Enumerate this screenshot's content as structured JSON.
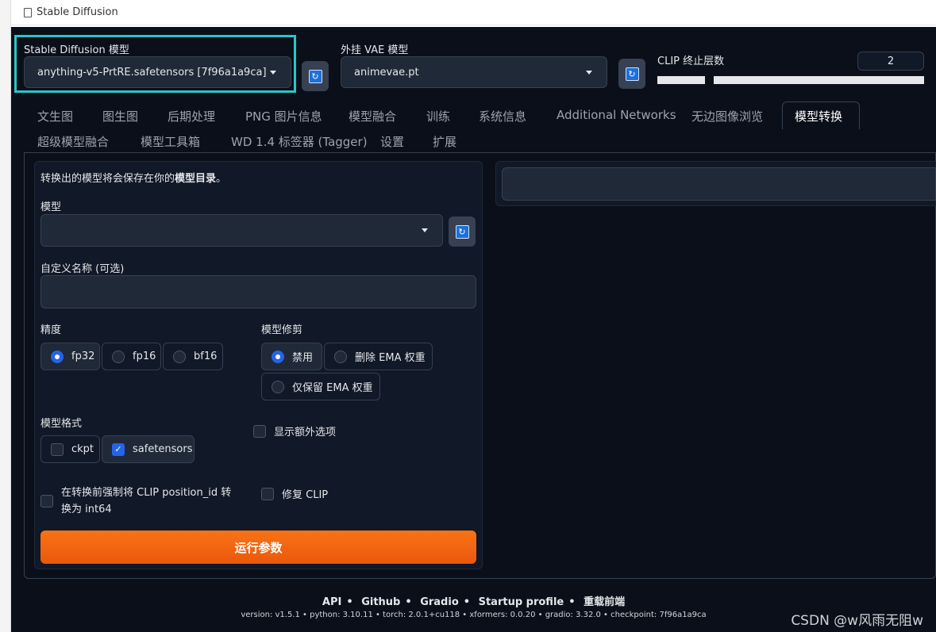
{
  "window": {
    "title": "Stable Diffusion"
  },
  "header": {
    "model_label": "Stable Diffusion 模型",
    "model_value": "anything-v5-PrtRE.safetensors [7f96a1a9ca]",
    "vae_label": "外挂 VAE 模型",
    "vae_value": "animevae.pt",
    "clip_label": "CLIP 终止层数",
    "clip_value": "2",
    "clip_slider": {
      "min": 1,
      "max": 12,
      "value": 2
    }
  },
  "tabs": {
    "row1": [
      "文生图",
      "图生图",
      "后期处理",
      "PNG 图片信息",
      "模型融合",
      "训练",
      "系统信息",
      "Additional Networks",
      "无边图像浏览",
      "模型转换"
    ],
    "row2": [
      "超级模型融合",
      "模型工具箱",
      "WD 1.4 标签器 (Tagger)",
      "设置",
      "扩展"
    ],
    "active": "模型转换"
  },
  "form": {
    "info_prefix": "转换出的模型将会保存在你的",
    "info_bold": "模型目录",
    "info_suffix": "。",
    "model_label": "模型",
    "model_value": "",
    "custom_name_label": "自定义名称 (可选)",
    "custom_name_value": "",
    "precision_label": "精度",
    "precision_options": [
      "fp32",
      "fp16",
      "bf16"
    ],
    "precision_selected": "fp32",
    "prune_label": "模型修剪",
    "prune_options": [
      "禁用",
      "删除 EMA 权重",
      "仅保留 EMA 权重"
    ],
    "prune_selected": "禁用",
    "format_label": "模型格式",
    "format_options": [
      "ckpt",
      "safetensors"
    ],
    "format_selected": "safetensors",
    "show_extra_label": "显示额外选项",
    "force_clip_label": "在转换前强制将 CLIP position_id 转换为 int64",
    "fix_clip_label": "修复 CLIP",
    "run_label": "运行参数"
  },
  "footer": {
    "links": [
      "API",
      "Github",
      "Gradio",
      "Startup profile",
      "重载前端"
    ],
    "version_text": "version: v1.5.1  •  python: 3.10.11  •  torch: 2.0.1+cu118  •  xformers: 0.0.20  •  gradio: 3.32.0  •  checkpoint: 7f96a1a9ca"
  },
  "watermark": "CSDN @w风雨无阻w",
  "colors": {
    "background": "#0b0f19",
    "panel": "#111827",
    "accent": "#2563eb",
    "button": "#ea580c",
    "highlight_border": "#2ac6c6"
  }
}
